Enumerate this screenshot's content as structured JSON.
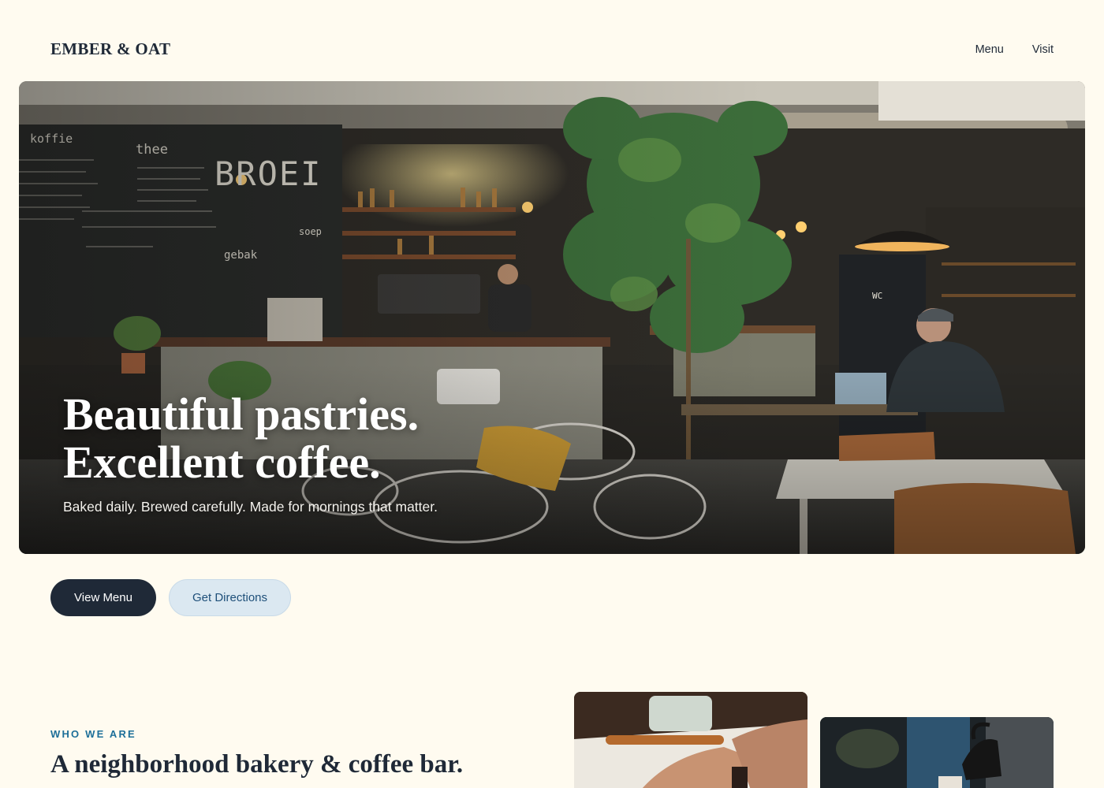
{
  "header": {
    "brand": "EMBER & OAT",
    "nav": [
      {
        "label": "Menu"
      },
      {
        "label": "Visit"
      }
    ]
  },
  "hero": {
    "title_line1": "Beautiful pastries.",
    "title_line2": "Excellent coffee.",
    "subtitle": "Baked daily. Brewed carefully. Made for mornings that matter.",
    "chalkboard_words": [
      "koffie",
      "thee",
      "BROEI",
      "gebak",
      "soep",
      "WC"
    ]
  },
  "actions": {
    "primary_label": "View Menu",
    "secondary_label": "Get Directions"
  },
  "about": {
    "eyebrow": "WHO WE ARE",
    "title": "A neighborhood bakery & coffee bar."
  },
  "colors": {
    "background": "#fffbf0",
    "ink": "#1f2937",
    "accent": "#1d6f99",
    "secondary_button_bg": "#dbe8f1"
  }
}
